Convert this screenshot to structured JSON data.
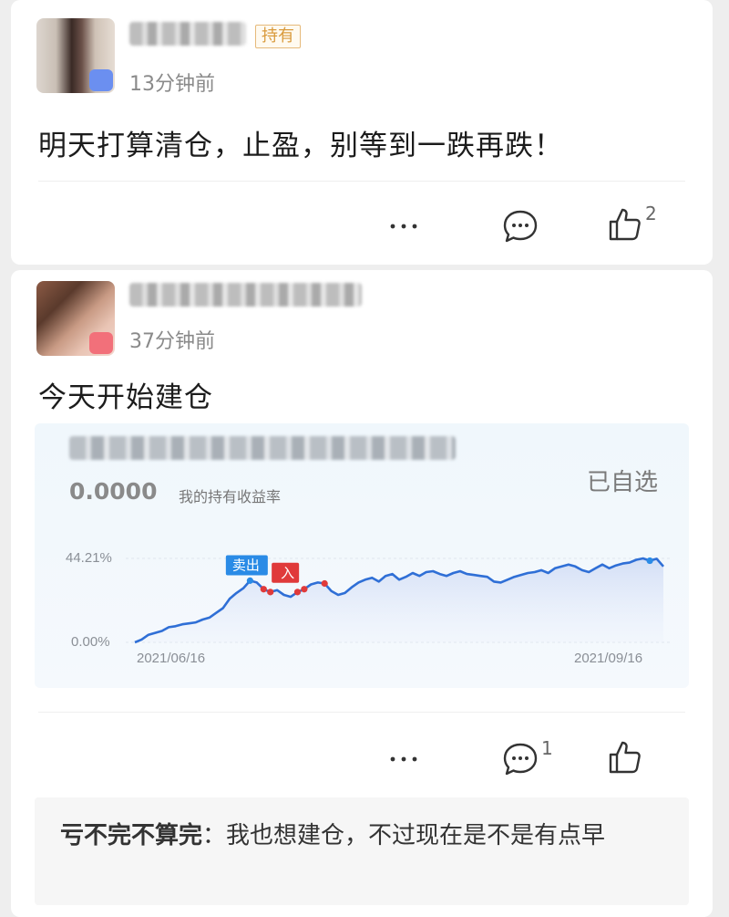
{
  "post1": {
    "badge": "持有",
    "time": "13分钟前",
    "content": "明天打算清仓，止盈，别等到一跌再跌！",
    "actions": {
      "more_icon": "more-dots-icon",
      "comment_icon": "comment-icon",
      "like_icon": "thumbs-up-icon",
      "like_count": "2"
    }
  },
  "post2": {
    "time": "37分钟前",
    "content": "今天开始建仓",
    "fund_card": {
      "starred_label": "已自选",
      "rate_value": "0.0000",
      "rate_label": "我的持有收益率"
    },
    "actions": {
      "more_icon": "more-dots-icon",
      "comment_icon": "comment-icon",
      "comment_count": "1",
      "like_icon": "thumbs-up-icon"
    },
    "comment": {
      "author": "亏不完不算完",
      "separator": "：",
      "text": "我也想建仓，不过现在是不是有点早"
    }
  },
  "chart_data": {
    "type": "line",
    "x_start": "2021/06/16",
    "x_end": "2021/09/16",
    "y_ticks": [
      "44.21%",
      "0.00%"
    ],
    "ylim": [
      0,
      44.21
    ],
    "series": [
      {
        "color": "#2f6fd6",
        "values": [
          0,
          1.5,
          4,
          5,
          6,
          8,
          8.5,
          9.5,
          10,
          10.5,
          12,
          13,
          15.5,
          18,
          23,
          26,
          28.5,
          32.5,
          31.5,
          28,
          26.5,
          27.5,
          25,
          24,
          26.5,
          28,
          30.5,
          31.5,
          31,
          27,
          25,
          26,
          29,
          31.5,
          33,
          34,
          32,
          35,
          36,
          33,
          34.5,
          36.5,
          35,
          37,
          37.5,
          36,
          35,
          36.5,
          37.5,
          36,
          35.5,
          35,
          34.5,
          32,
          31.5,
          33,
          34.5,
          35.5,
          36.5,
          37,
          38,
          36.5,
          39,
          40,
          41,
          40,
          38,
          37,
          39,
          41,
          39,
          40.5,
          41.5,
          42,
          43.5,
          44.21,
          43,
          44,
          40
        ]
      }
    ],
    "markers": [
      {
        "label": "卖出",
        "kind": "sell",
        "color": "#2a8be6",
        "index": 18
      },
      {
        "label": "入",
        "kind": "buy",
        "color": "#e03a3a",
        "index": 21
      }
    ]
  }
}
